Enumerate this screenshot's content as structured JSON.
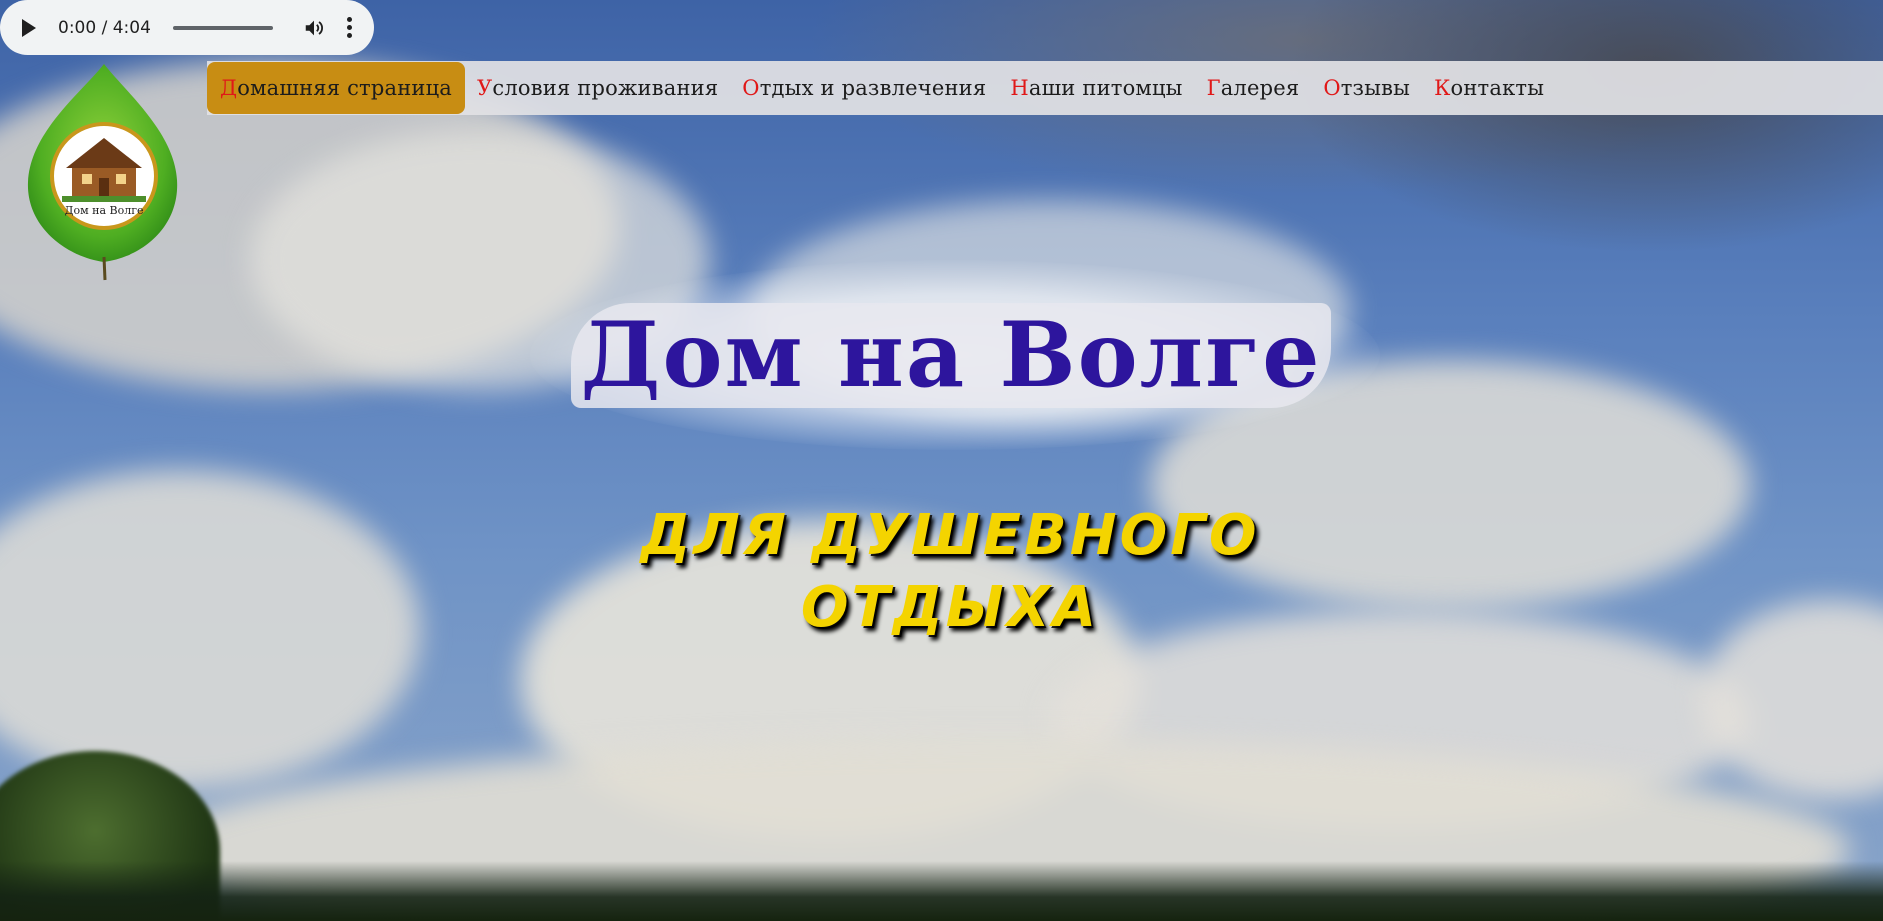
{
  "audio": {
    "time": "0:00 / 4:04",
    "play_icon": "play-icon",
    "volume_icon": "volume-icon",
    "more_icon": "more-vert-icon",
    "progress": 0
  },
  "logo": {
    "text": "Дом на Волге",
    "icon": "birch-leaf-house-logo"
  },
  "nav": {
    "items": [
      {
        "first": "Д",
        "rest": "омашняя страница",
        "active": true
      },
      {
        "first": "У",
        "rest": "словия проживания",
        "active": false
      },
      {
        "first": "О",
        "rest": "тдых и развлечения",
        "active": false
      },
      {
        "first": "Н",
        "rest": "аши питомцы",
        "active": false
      },
      {
        "first": "Г",
        "rest": "алерея",
        "active": false
      },
      {
        "first": "О",
        "rest": "тзывы",
        "active": false
      },
      {
        "first": "К",
        "rest": "онтакты",
        "active": false
      }
    ]
  },
  "hero": {
    "title": "Дом на Волге",
    "subtitle_line1": "для душевного",
    "subtitle_line2": "отдыха"
  },
  "colors": {
    "title": "#2d159d",
    "subtitle": "#f4d400",
    "nav_active": "#c88d13",
    "nav_first_letter": "#e01818"
  }
}
